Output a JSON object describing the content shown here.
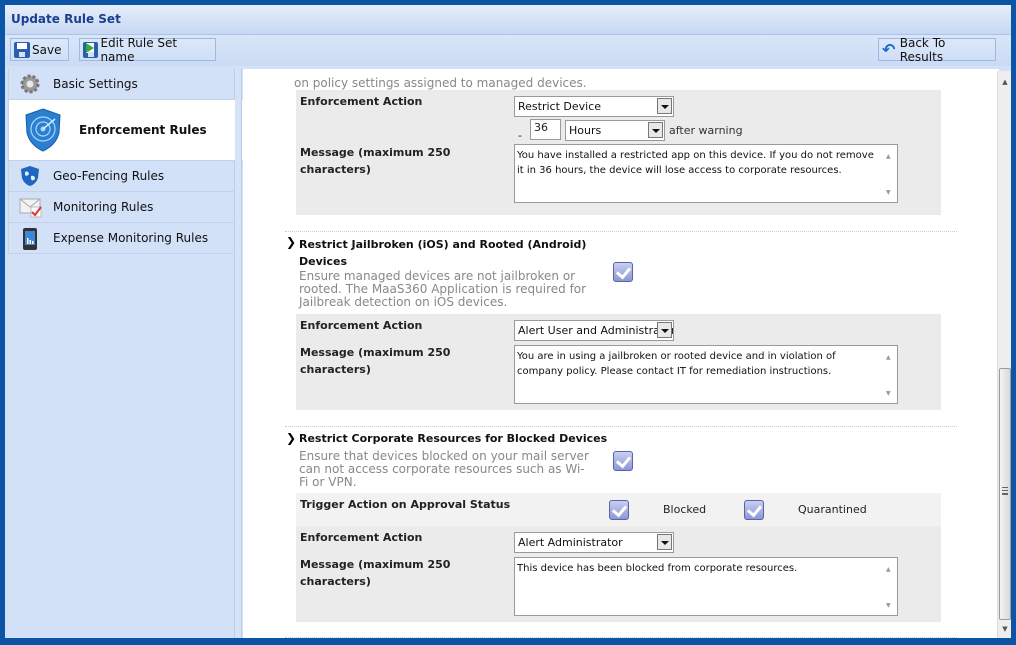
{
  "window": {
    "title": "Update Rule Set"
  },
  "toolbar": {
    "save_label": "Save",
    "edit_name_label": "Edit Rule Set name",
    "back_label": "Back To Results"
  },
  "sidebar": {
    "items": [
      {
        "label": "Basic Settings",
        "icon": "gear-icon",
        "active": false
      },
      {
        "label": "Enforcement Rules",
        "icon": "shield-radar-icon",
        "active": true
      },
      {
        "label": "Geo-Fencing Rules",
        "icon": "globe-shield-icon",
        "active": false
      },
      {
        "label": "Monitoring Rules",
        "icon": "mail-check-icon",
        "active": false
      },
      {
        "label": "Expense Monitoring Rules",
        "icon": "phone-chart-icon",
        "active": false
      }
    ]
  },
  "content": {
    "top_partial_text": "on policy settings assigned to managed devices.",
    "section1": {
      "enforcement_label": "Enforcement Action",
      "enforcement_value": "Restrict Device",
      "dash": "-",
      "delay_value": "36",
      "delay_unit": "Hours",
      "after_warning": "after warning",
      "message_label_1": "Message (maximum 250",
      "message_label_2": "characters)",
      "message": "You have installed a restricted app on this device. If you do not remove it in 36 hours, the device will lose access to corporate resources."
    },
    "section2": {
      "title_1": "Restrict Jailbroken (iOS) and Rooted (Android)",
      "title_2": "Devices",
      "description": "Ensure managed devices are not jailbroken or rooted. The MaaS360 Application is required for Jailbreak detection on iOS devices.",
      "enabled": true,
      "enforcement_label": "Enforcement Action",
      "enforcement_value": "Alert User and Administrator",
      "message_label_1": "Message (maximum 250",
      "message_label_2": "characters)",
      "message": "You are in using a jailbroken or rooted device and in violation of company policy. Please contact IT for remediation instructions."
    },
    "section3": {
      "title": "Restrict Corporate Resources for Blocked Devices",
      "description": "Ensure that devices blocked on your mail server can not access corporate resources such as Wi-Fi or VPN.",
      "enabled": true,
      "trigger_label": "Trigger Action on Approval Status",
      "blocked_label": "Blocked",
      "blocked_checked": true,
      "quarantined_label": "Quarantined",
      "quarantined_checked": true,
      "enforcement_label": "Enforcement Action",
      "enforcement_value": "Alert Administrator",
      "message_label_1": "Message (maximum 250",
      "message_label_2": "characters)",
      "message": "This device has been blocked from corporate resources."
    },
    "chevron": "❯"
  },
  "scrollbar": {
    "up": "▲",
    "down": "▼"
  }
}
